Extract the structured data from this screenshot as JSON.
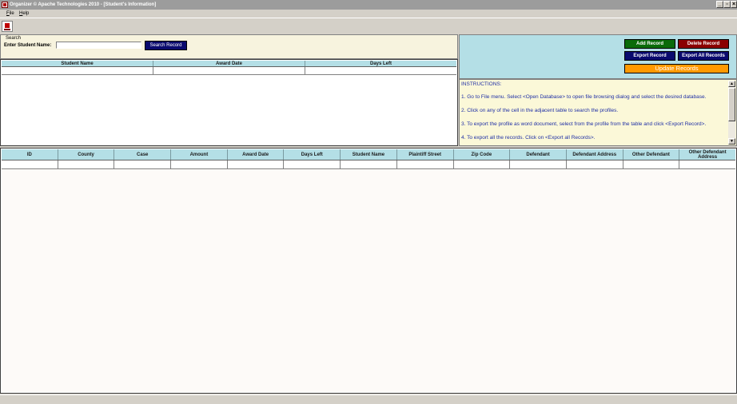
{
  "window": {
    "title": "Organizer © Apache Technologies 2010 - [Student's Information]"
  },
  "menu": {
    "file": "File",
    "help": "Help"
  },
  "search": {
    "legend": "Search",
    "label": "Enter Student Name:",
    "value": "",
    "button": "Search Record"
  },
  "results_table": {
    "headers": [
      "Student Name",
      "Award Date",
      "Days Left"
    ]
  },
  "actions": {
    "add": "Add Record",
    "delete": "Delete Record",
    "export": "Export Record",
    "export_all": "Export All Records",
    "update": "Update Records"
  },
  "instructions": {
    "title": "INSTRUCTIONS:",
    "items": [
      "1. Go to File menu. Select <Open Database> to open file browsing dialog and select the desired database.",
      "2. Click on any of the cell in the adjacent table to search the profiles.",
      "3. To export the profile as word document, select from the profile from the table and click <Export Record>.",
      "4. To export all the records. Click on <Export all Records>."
    ]
  },
  "main_table": {
    "headers": [
      "ID",
      "County",
      "Case",
      "Amount",
      "Award Date",
      "Days Left",
      "Student Name",
      "Plaintiff Street",
      "Zip Code",
      "Defendant",
      "Defendant Address",
      "Other Defendant",
      "Other Defendant Address"
    ]
  },
  "colors": {
    "header_bg": "#b4dfe6",
    "add_button": "#0a6b0a",
    "delete_button": "#8b0000",
    "export_button": "#0a0a6e",
    "update_button": "#ff9900",
    "instructions_text": "#1f2fa5"
  }
}
